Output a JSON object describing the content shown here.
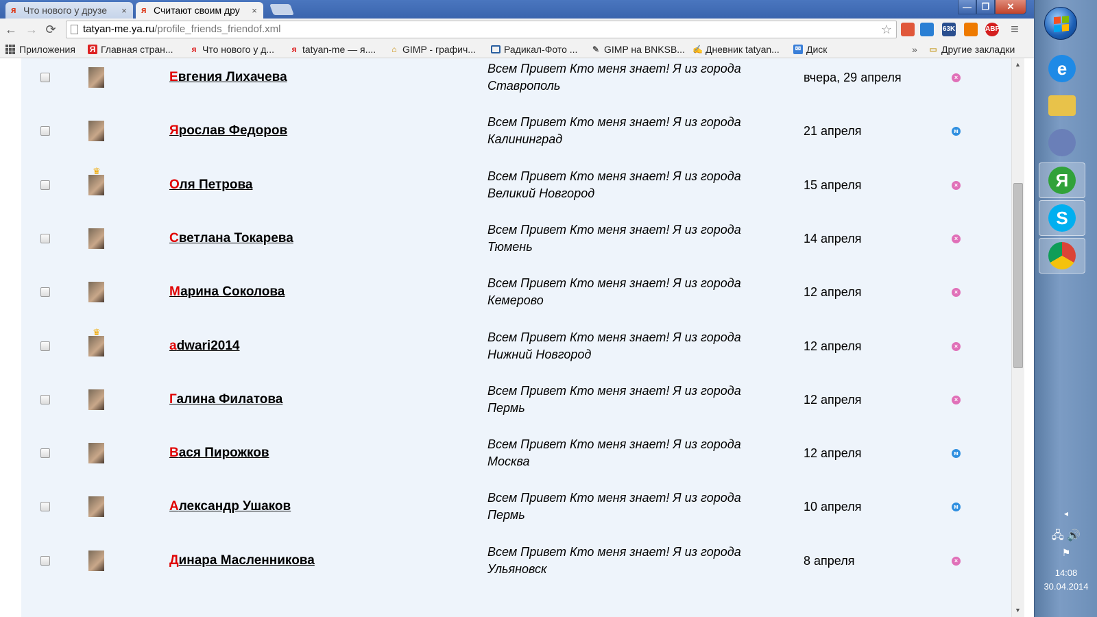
{
  "browser": {
    "tabs": [
      {
        "title": "Что нового у друзе",
        "active": false
      },
      {
        "title": "Считают своим дру",
        "active": true
      }
    ],
    "tab_close": "×",
    "window_buttons": {
      "minimize": "—",
      "maximize": "❐",
      "close": "✕"
    },
    "nav": {
      "back": "←",
      "forward": "→",
      "reload": "⟳"
    },
    "url": {
      "host": "tatyan-me.ya.ru",
      "path": "/profile_friends_friendof.xml"
    },
    "star": "☆",
    "extensions": [
      {
        "label": "",
        "color": "#e0573a"
      },
      {
        "label": "",
        "color": "#2a7fd4"
      },
      {
        "label": "63K",
        "color": "#2a4f8f"
      },
      {
        "label": "",
        "color": "#ee7a00"
      },
      {
        "label": "ABP",
        "color": "#d42020"
      }
    ],
    "menu": "≡",
    "bookmarks": [
      {
        "label": "Приложения",
        "icon": "apps-grid-icon"
      },
      {
        "label": "Главная стран...",
        "icon": "yandex-icon"
      },
      {
        "label": "Что нового у д...",
        "icon": "yaru-icon"
      },
      {
        "label": "tatyan-me — я....",
        "icon": "yaru-icon"
      },
      {
        "label": "GIMP - графич...",
        "icon": "gimp-icon"
      },
      {
        "label": "Радикал-Фото ...",
        "icon": "photo-icon"
      },
      {
        "label": "GIMP на BNKSB...",
        "icon": "gimp-icon"
      },
      {
        "label": "Дневник tatyan...",
        "icon": "diary-icon"
      },
      {
        "label": "Диск",
        "icon": "disk-icon"
      }
    ],
    "bookmarks_more": "»",
    "other_bookmarks": "Другие закладки"
  },
  "friends": [
    {
      "initial": "Е",
      "rest": "вгения Лихачева",
      "status_line1": "Всем Привет Кто меня знает! Я из города",
      "status_line2": "Ставрополь",
      "date": "вчера, 29 апреля",
      "gender": "f",
      "crown": false
    },
    {
      "initial": "Я",
      "rest": "рослав Федоров",
      "status_line1": "Всем Привет Кто меня знает! Я из города",
      "status_line2": "Калининград",
      "date": "21 апреля",
      "gender": "m",
      "crown": false
    },
    {
      "initial": "О",
      "rest": "ля Петрова",
      "status_line1": "Всем Привет Кто меня знает! Я из города",
      "status_line2": "Великий Новгород",
      "date": "15 апреля",
      "gender": "f",
      "crown": true
    },
    {
      "initial": "С",
      "rest": "ветлана Токарева",
      "status_line1": "Всем Привет Кто меня знает! Я из города",
      "status_line2": "Тюмень",
      "date": "14 апреля",
      "gender": "f",
      "crown": false
    },
    {
      "initial": "М",
      "rest": "арина Соколова",
      "status_line1": "Всем Привет Кто меня знает! Я из города",
      "status_line2": "Кемерово",
      "date": "12 апреля",
      "gender": "f",
      "crown": false
    },
    {
      "initial": "a",
      "rest": "dwari2014",
      "status_line1": "Всем Привет Кто меня знает! Я из города",
      "status_line2": "Нижний Новгород",
      "date": "12 апреля",
      "gender": "f",
      "crown": true
    },
    {
      "initial": "Г",
      "rest": "алина Филатова",
      "status_line1": "Всем Привет Кто меня знает! Я из города",
      "status_line2": "Пермь",
      "date": "12 апреля",
      "gender": "f",
      "crown": false
    },
    {
      "initial": "В",
      "rest": "ася Пирожков",
      "status_line1": "Всем Привет Кто меня знает! Я из города",
      "status_line2": "Москва",
      "date": "12 апреля",
      "gender": "m",
      "crown": false
    },
    {
      "initial": "А",
      "rest": "лександр Ушаков",
      "status_line1": "Всем Привет Кто меня знает! Я из города",
      "status_line2": "Пермь",
      "date": "10 апреля",
      "gender": "m",
      "crown": false
    },
    {
      "initial": "Д",
      "rest": "инара Масленникова",
      "status_line1": "Всем Привет Кто меня знает! Я из города",
      "status_line2": "Ульяновск",
      "date": "8 апреля",
      "gender": "f",
      "crown": false
    }
  ],
  "gender_glyphs": {
    "f": "×",
    "m": "м"
  },
  "taskbar": {
    "apps": [
      {
        "name": "ie-icon",
        "glyph": "e",
        "color": "#1e8ae6"
      },
      {
        "name": "explorer-folder-icon",
        "glyph": "",
        "color": "#e8c24a"
      },
      {
        "name": "paint-icon",
        "glyph": "",
        "color": "#6a7fb8"
      },
      {
        "name": "yandex-browser-icon",
        "glyph": "Я",
        "color": "#31a23a"
      },
      {
        "name": "skype-icon",
        "glyph": "S",
        "color": "#00aff0"
      },
      {
        "name": "chrome-icon",
        "glyph": "",
        "color": "#db4437"
      }
    ],
    "tray_arrow": "◂",
    "time": "14:08",
    "date": "30.04.2014"
  }
}
